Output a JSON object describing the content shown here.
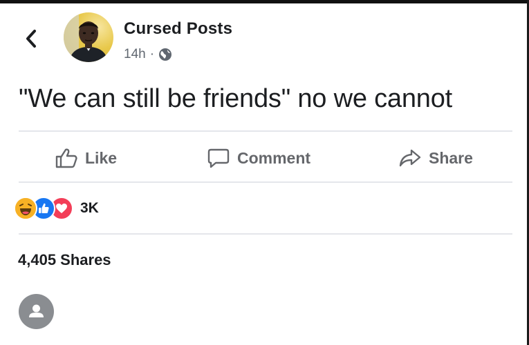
{
  "post": {
    "author": "Cursed Posts",
    "time": "14h",
    "separator": "·",
    "privacy_icon": "globe-icon",
    "text": "\"We can still be friends\" no we cannot"
  },
  "actions": {
    "like_label": "Like",
    "comment_label": "Comment",
    "share_label": "Share"
  },
  "reactions": {
    "icons": [
      "haha-icon",
      "like-icon",
      "love-icon"
    ],
    "count": "3K"
  },
  "shares_text": "4,405 Shares",
  "colors": {
    "text": "#1c1e21",
    "muted": "#65676b",
    "divider": "#e4e6eb",
    "like_blue": "#1877f2",
    "love_red": "#f33e58",
    "haha_yellow": "#f7b125"
  }
}
